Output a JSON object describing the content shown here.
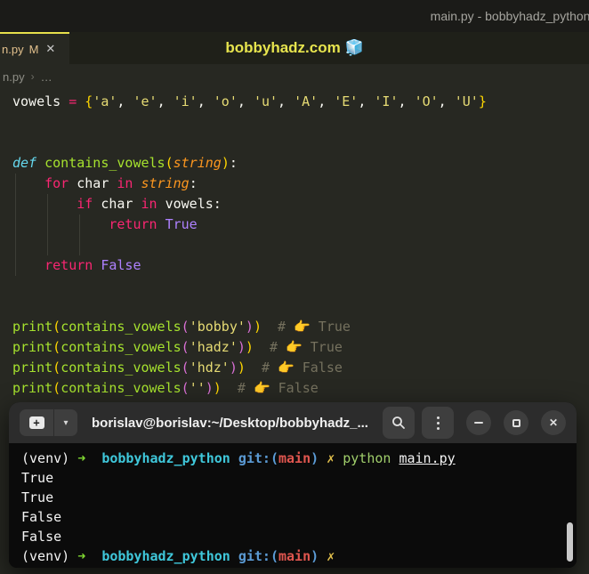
{
  "titlebar": {
    "text": "main.py - bobbyhadz_python -"
  },
  "tabbar": {
    "tab": {
      "label": "n.py",
      "modified_badge": "M",
      "close_glyph": "✕"
    },
    "center_title": "bobbyhadz.com 🧊",
    "active_tab_accent": "#e7e04b"
  },
  "breadcrumb": {
    "file": "n.py",
    "separator": "›",
    "ellipsis": "…"
  },
  "editor": {
    "background": "#272822",
    "palette": {
      "plain": {
        "c": "#f8f8f2"
      },
      "kw": {
        "c": "#f92672"
      },
      "defkw": {
        "c": "#66d9ef",
        "i": 1
      },
      "fn": {
        "c": "#a6e22e"
      },
      "param": {
        "c": "#fd971f",
        "i": 1
      },
      "str": {
        "c": "#e6db74"
      },
      "const": {
        "c": "#ae81ff"
      },
      "comment": {
        "c": "#75715e"
      },
      "b1": {
        "c": "#ffd700"
      },
      "b2": {
        "c": "#da70d6"
      },
      "emoji": {
        "c": "#f5c842"
      }
    },
    "code_lines": [
      [
        [
          "plain",
          "vowels "
        ],
        [
          "kw",
          "="
        ],
        [
          "plain",
          " "
        ],
        [
          "b1",
          "{"
        ],
        [
          "str",
          "'a'"
        ],
        [
          "plain",
          ", "
        ],
        [
          "str",
          "'e'"
        ],
        [
          "plain",
          ", "
        ],
        [
          "str",
          "'i'"
        ],
        [
          "plain",
          ", "
        ],
        [
          "str",
          "'o'"
        ],
        [
          "plain",
          ", "
        ],
        [
          "str",
          "'u'"
        ],
        [
          "plain",
          ", "
        ],
        [
          "str",
          "'A'"
        ],
        [
          "plain",
          ", "
        ],
        [
          "str",
          "'E'"
        ],
        [
          "plain",
          ", "
        ],
        [
          "str",
          "'I'"
        ],
        [
          "plain",
          ", "
        ],
        [
          "str",
          "'O'"
        ],
        [
          "plain",
          ", "
        ],
        [
          "str",
          "'U'"
        ],
        [
          "b1",
          "}"
        ]
      ],
      [],
      [],
      [
        [
          "defkw",
          "def"
        ],
        [
          "plain",
          " "
        ],
        [
          "fn",
          "contains_vowels"
        ],
        [
          "b1",
          "("
        ],
        [
          "param",
          "string"
        ],
        [
          "b1",
          ")"
        ],
        [
          "plain",
          ":"
        ]
      ],
      [
        [
          "plain",
          "    "
        ],
        [
          "kw",
          "for"
        ],
        [
          "plain",
          " char "
        ],
        [
          "kw",
          "in"
        ],
        [
          "plain",
          " "
        ],
        [
          "param",
          "string"
        ],
        [
          "plain",
          ":"
        ]
      ],
      [
        [
          "plain",
          "        "
        ],
        [
          "kw",
          "if"
        ],
        [
          "plain",
          " char "
        ],
        [
          "kw",
          "in"
        ],
        [
          "plain",
          " vowels:"
        ]
      ],
      [
        [
          "plain",
          "            "
        ],
        [
          "kw",
          "return"
        ],
        [
          "plain",
          " "
        ],
        [
          "const",
          "True"
        ]
      ],
      [],
      [
        [
          "plain",
          "    "
        ],
        [
          "kw",
          "return"
        ],
        [
          "plain",
          " "
        ],
        [
          "const",
          "False"
        ]
      ],
      [],
      [],
      [
        [
          "fn",
          "print"
        ],
        [
          "b1",
          "("
        ],
        [
          "fn",
          "contains_vowels"
        ],
        [
          "b2",
          "("
        ],
        [
          "str",
          "'bobby'"
        ],
        [
          "b2",
          ")"
        ],
        [
          "b1",
          ")"
        ],
        [
          "plain",
          "  "
        ],
        [
          "comment",
          "# "
        ],
        [
          "emoji",
          "👉"
        ],
        [
          "comment",
          " True"
        ]
      ],
      [
        [
          "fn",
          "print"
        ],
        [
          "b1",
          "("
        ],
        [
          "fn",
          "contains_vowels"
        ],
        [
          "b2",
          "("
        ],
        [
          "str",
          "'hadz'"
        ],
        [
          "b2",
          ")"
        ],
        [
          "b1",
          ")"
        ],
        [
          "plain",
          "  "
        ],
        [
          "comment",
          "# "
        ],
        [
          "emoji",
          "👉"
        ],
        [
          "comment",
          " True"
        ]
      ],
      [
        [
          "fn",
          "print"
        ],
        [
          "b1",
          "("
        ],
        [
          "fn",
          "contains_vowels"
        ],
        [
          "b2",
          "("
        ],
        [
          "str",
          "'hdz'"
        ],
        [
          "b2",
          ")"
        ],
        [
          "b1",
          ")"
        ],
        [
          "plain",
          "  "
        ],
        [
          "comment",
          "# "
        ],
        [
          "emoji",
          "👉"
        ],
        [
          "comment",
          " False"
        ]
      ],
      [
        [
          "fn",
          "print"
        ],
        [
          "b1",
          "("
        ],
        [
          "fn",
          "contains_vowels"
        ],
        [
          "b2",
          "("
        ],
        [
          "str",
          "''"
        ],
        [
          "b2",
          ")"
        ],
        [
          "b1",
          ")"
        ],
        [
          "plain",
          "  "
        ],
        [
          "comment",
          "# "
        ],
        [
          "emoji",
          "👉"
        ],
        [
          "comment",
          " False"
        ]
      ]
    ]
  },
  "terminal": {
    "header": {
      "title": "borislav@borislav:~/Desktop/bobbyhadz_...",
      "dropdown_glyph": "▾",
      "newtab_glyph": "+"
    },
    "background": "#0b0b0b",
    "palette": {
      "white": {
        "c": "#f4f4f4"
      },
      "arrow": {
        "c": "#80d932",
        "b": 1
      },
      "cyan": {
        "c": "#3fc7da",
        "b": 1
      },
      "blue": {
        "c": "#5b9bd5",
        "b": 1
      },
      "red": {
        "c": "#e0564f",
        "b": 1
      },
      "yellow": {
        "c": "#e2c04c"
      },
      "lgreen": {
        "c": "#a0ce6b"
      },
      "file": {
        "c": "#f4f4f4",
        "u": 1
      }
    },
    "lines": [
      [
        [
          "white",
          "(venv) "
        ],
        [
          "arrow",
          "➜"
        ],
        [
          "white",
          "  "
        ],
        [
          "cyan",
          "bobbyhadz_python"
        ],
        [
          "white",
          " "
        ],
        [
          "blue",
          "git:("
        ],
        [
          "red",
          "main"
        ],
        [
          "blue",
          ")"
        ],
        [
          "white",
          " "
        ],
        [
          "yellow",
          "✗"
        ],
        [
          "white",
          " "
        ],
        [
          "lgreen",
          "python"
        ],
        [
          "white",
          " "
        ],
        [
          "file",
          "main.py"
        ]
      ],
      [
        [
          "white",
          "True"
        ]
      ],
      [
        [
          "white",
          "True"
        ]
      ],
      [
        [
          "white",
          "False"
        ]
      ],
      [
        [
          "white",
          "False"
        ]
      ],
      [
        [
          "white",
          "(venv) "
        ],
        [
          "arrow",
          "➜"
        ],
        [
          "white",
          "  "
        ],
        [
          "cyan",
          "bobbyhadz_python"
        ],
        [
          "white",
          " "
        ],
        [
          "blue",
          "git:("
        ],
        [
          "red",
          "main"
        ],
        [
          "blue",
          ")"
        ],
        [
          "white",
          " "
        ],
        [
          "yellow",
          "✗"
        ]
      ]
    ]
  }
}
